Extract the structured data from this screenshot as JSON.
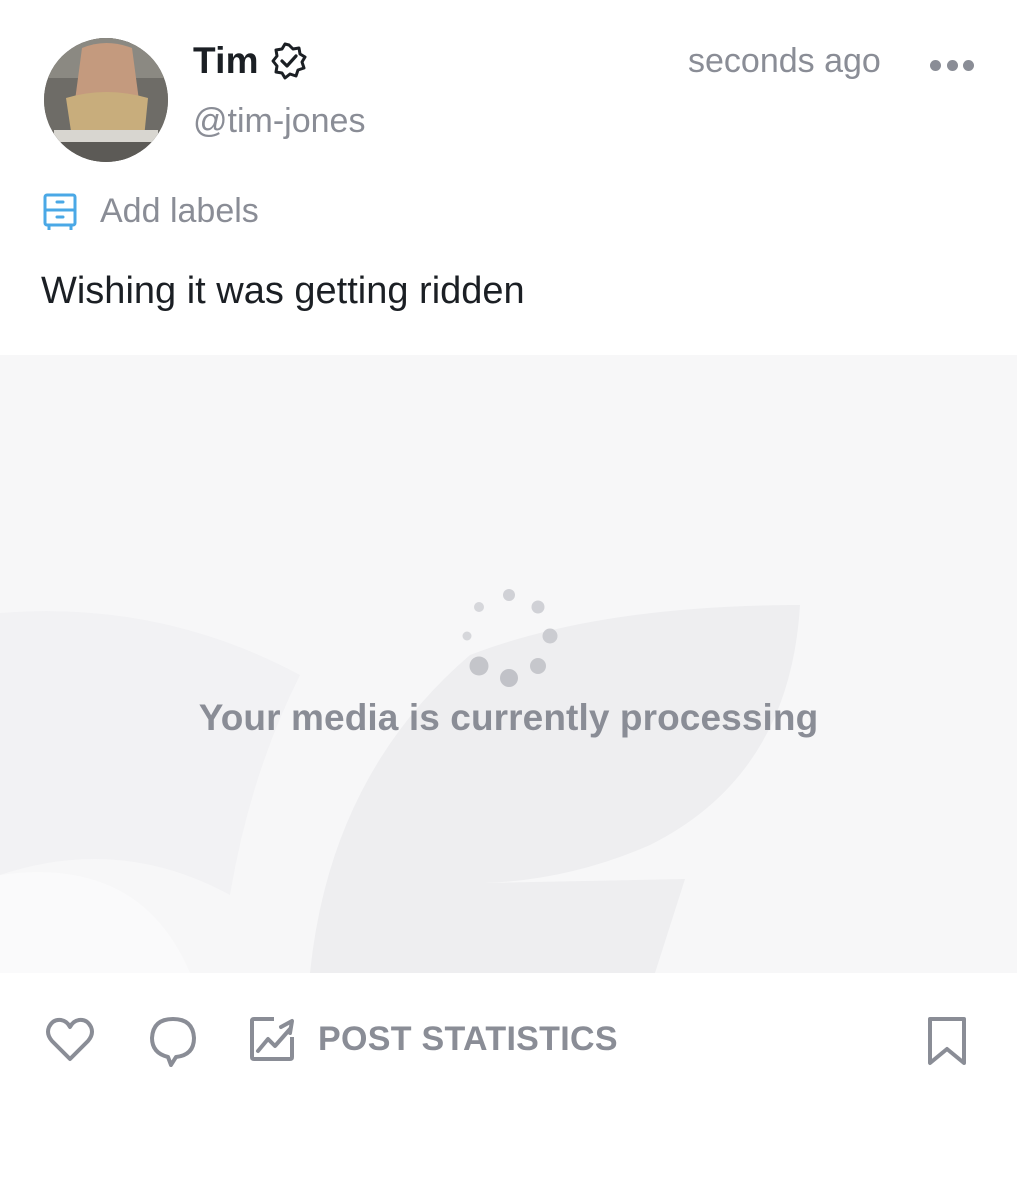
{
  "post": {
    "author": {
      "display_name": "Tim",
      "handle": "@tim-jones",
      "verified": true
    },
    "timestamp": "seconds ago",
    "labels_action": "Add labels",
    "text": "Wishing it was getting ridden",
    "media": {
      "status_message": "Your media is currently processing"
    },
    "actions": {
      "statistics_label": "POST STATISTICS"
    }
  },
  "colors": {
    "muted_text": "#8a8d96",
    "primary_text": "#1b1f24",
    "accent_blue": "#4aa8e6",
    "media_background": "#f7f7f8"
  },
  "icons": [
    "verified-badge-icon",
    "more-options-icon",
    "labels-icon",
    "spinner-icon",
    "heart-icon",
    "comment-icon",
    "statistics-icon",
    "bookmark-icon"
  ]
}
